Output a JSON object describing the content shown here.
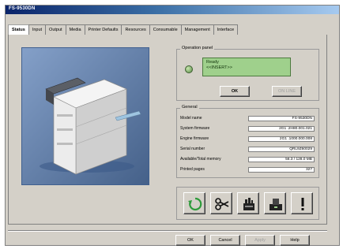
{
  "window": {
    "title": "FS-9530DN"
  },
  "tabs": [
    {
      "label": "Status",
      "active": true
    },
    {
      "label": "Input"
    },
    {
      "label": "Output"
    },
    {
      "label": "Media"
    },
    {
      "label": "Printer Defaults"
    },
    {
      "label": "Resources"
    },
    {
      "label": "Consumable"
    },
    {
      "label": "Management"
    },
    {
      "label": "Interface"
    }
  ],
  "operation_panel": {
    "group_label": "Operation panel",
    "display_line1": "Ready",
    "display_line2": "<<INSERT>>",
    "ok_label": "OK",
    "online_label": "ON LINE"
  },
  "general": {
    "group_label": "General",
    "rows": [
      {
        "label": "Model name",
        "value": "FS-9530DN"
      },
      {
        "label": "System firmware",
        "value": "2G1 .2H80.001.021"
      },
      {
        "label": "Engine firmware",
        "value": "2G1 .1000.000.008"
      },
      {
        "label": "Serial number",
        "value": "QRL9Z60029"
      },
      {
        "label": "Available/Total memory",
        "value": "56.3 / 128.0 MB"
      },
      {
        "label": "Printed pages",
        "value": "327"
      }
    ]
  },
  "tools": [
    {
      "name": "refresh-icon"
    },
    {
      "name": "scissors-icon"
    },
    {
      "name": "printer-tray-icon"
    },
    {
      "name": "printer-status-icon"
    },
    {
      "name": "warning-exclamation-icon"
    }
  ],
  "buttons": {
    "ok": "OK",
    "cancel": "Cancel",
    "apply": "Apply",
    "help": "Help"
  },
  "colors": {
    "lcd_background": "#9fd08c",
    "led": "#5a8a46",
    "printer_background": "#5a7fb5",
    "refresh_green": "#2d9a3a"
  }
}
